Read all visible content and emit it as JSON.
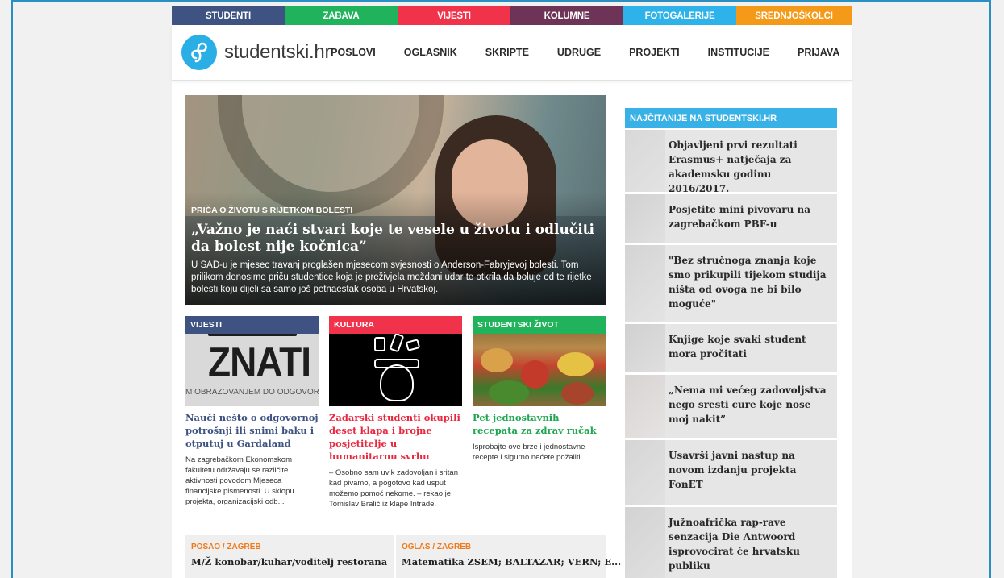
{
  "topbar": [
    {
      "label": "STUDENTI",
      "color": "#3e5381"
    },
    {
      "label": "ZABAVA",
      "color": "#21b35b"
    },
    {
      "label": "VIJESTI",
      "color": "#f0334a"
    },
    {
      "label": "KOLUMNE",
      "color": "#6d3458"
    },
    {
      "label": "FOTOGALERIJE",
      "color": "#2eb2ea"
    },
    {
      "label": "SREDNJOŠKOLCI",
      "color": "#f59a18"
    }
  ],
  "header": {
    "logo_text": "studentski.hr",
    "nav": [
      "POSLOVI",
      "OGLASNIK",
      "SKRIPTE",
      "UDRUGE",
      "PROJEKTI",
      "INSTITUCIJE",
      "PRIJAVA"
    ]
  },
  "hero": {
    "kicker": "PRIČA O ŽIVOTU S RIJETKOM BOLESTI",
    "title": "„Važno je naći stvari koje te vesele u životu i odlučiti da bolest nije kočnica”",
    "desc": "U SAD-u je mjesec travanj proglašen mjesecom svjesnosti o Anderson-Fabryjevoj bolesti. Tom prilikom donosimo priču studentice koja je preživjela moždani udar te otkrila da boluje od te rijetke bolesti koju dijeli sa samo još petnaestak osoba u Hrvatskoj."
  },
  "cards": [
    {
      "label": "VIJESTI",
      "color": "#3e5381",
      "image_text_big": "ZNATI",
      "image_text_small": "M OBRAZOVANJEM DO ODGOVORNE",
      "title": "Nauči nešto o odgovornoj potrošnji ili snimi baku i otputuj u Gardaland",
      "desc": "Na zagrebačkom Ekonomskom fakultetu održavaju se različite aktivnosti povodom Mjeseca financijske pismenosti. U sklopu projekta, organizacijski odb..."
    },
    {
      "label": "KULTURA",
      "color": "#f0334a",
      "title": "Zadarski studenti okupili deset klapa i brojne posjetitelje u humanitarnu svrhu",
      "desc": "– Osobno sam uvik zadovoljan i sritan kad pivamo, a pogotovo kad usput možemo pomoć nekome. – rekao je Tomislav Bralić iz klape Intrade."
    },
    {
      "label": "STUDENTSKI ŽIVOT",
      "color": "#21b35b",
      "title": "Pet jednostavnih recepata za zdrav ručak",
      "desc": "Isprobajte ove brze i jednostavne recepte i sigurno nećete požaliti."
    }
  ],
  "jobs": [
    {
      "category": "POSAO / ZAGREB",
      "title": "M/Ž konobar/kuhar/voditelj restorana"
    },
    {
      "category": "OGLAS / ZAGREB",
      "title": "Matematika ZSEM; BALTAZAR; VERN; E..."
    }
  ],
  "sidebar": {
    "heading": "NAJČITANIJE NA STUDENTSKI.HR",
    "items": [
      "Objavljeni prvi rezultati Erasmus+ natječaja za akademsku godinu 2016/2017.",
      "Posjetite mini pivovaru na zagrebačkom PBF-u",
      "\"Bez stručnoga znanja koje smo prikupili tijekom studija ništa od ovoga ne bi bilo moguće\"",
      "Knjige koje svaki student mora pročitati",
      "„Nema mi većeg zadovoljstva nego sresti cure koje nose moj nakit”",
      "Usavrši javni nastup na novom izdanju projekta FonET",
      "Južnoafrička rap-rave senzacija Die Antwoord isprovocirat će hrvatsku publiku"
    ]
  }
}
